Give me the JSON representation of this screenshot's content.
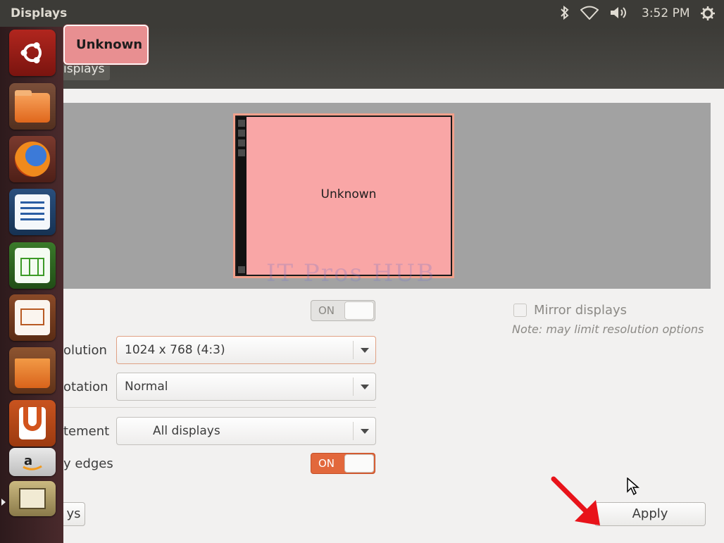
{
  "top_panel": {
    "title": "Displays",
    "clock": "3:52 PM",
    "indicators": [
      "bluetooth-icon",
      "wifi-icon",
      "volume-icon",
      "gear-icon"
    ]
  },
  "window": {
    "tab_label": "isplays"
  },
  "preview": {
    "monitor_label": "Unknown",
    "watermark": "IT Pros HUB"
  },
  "settings": {
    "power_toggle": "ON",
    "resolution_label": "olution",
    "resolution_value": "1024 x 768 (4:3)",
    "rotation_label": "otation",
    "rotation_value": "Normal",
    "placement_label": "tement",
    "placement_value": "All displays",
    "sticky_label": "y edges",
    "sticky_toggle": "ON"
  },
  "mirror": {
    "label": "Mirror displays",
    "note": "Note: may limit resolution options",
    "checked": false
  },
  "buttons": {
    "detect": "ys",
    "apply": "Apply"
  },
  "tooltip": {
    "text": "Unknown"
  },
  "launcher": {
    "items": [
      "ubuntu-dash-icon",
      "files-icon",
      "firefox-icon",
      "libreoffice-writer-icon",
      "libreoffice-calc-icon",
      "libreoffice-impress-icon",
      "software-center-icon",
      "ubuntu-one-icon",
      "amazon-icon",
      "system-settings-icon"
    ]
  },
  "colors": {
    "accent": "#e2683c",
    "monitor_fill": "#f9a6a6",
    "launcher_bg": "#3b1f22",
    "arrow": "#e8131a"
  }
}
